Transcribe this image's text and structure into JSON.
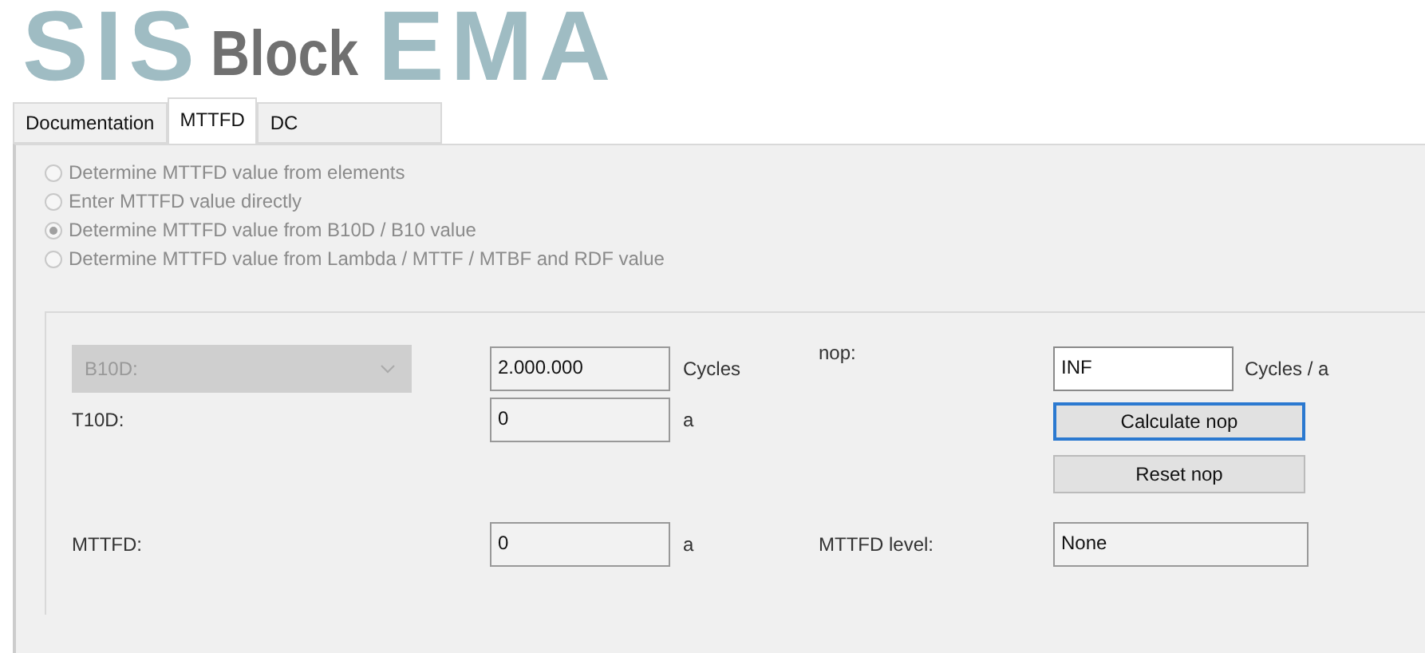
{
  "header": {
    "logo_parts": [
      "SIS",
      "EMA"
    ],
    "title": "Block"
  },
  "tabs": [
    {
      "label": "Documentation",
      "selected": false
    },
    {
      "label": "MTTFD",
      "selected": true
    },
    {
      "label": "DC",
      "selected": false
    }
  ],
  "options": [
    {
      "label": "Determine MTTFD value from elements",
      "selected": false,
      "disabled": true
    },
    {
      "label": "Enter MTTFD value directly",
      "selected": false,
      "disabled": true
    },
    {
      "label": "Determine MTTFD value from B10D / B10 value",
      "selected": true,
      "disabled": true
    },
    {
      "label": "Determine MTTFD value from Lambda / MTTF / MTBF and RDF value",
      "selected": false,
      "disabled": true
    }
  ],
  "form": {
    "b10d": {
      "select": "B10D:",
      "disabled": true,
      "value": "2.000.000",
      "unit": "Cycles"
    },
    "nop": {
      "label": "nop:",
      "value": "INF",
      "unit": "Cycles / a",
      "editable": true
    },
    "t10d": {
      "label": "T10D:",
      "value": "0",
      "unit": "a"
    },
    "buttons": [
      {
        "label": "Calculate nop",
        "focused": true
      },
      {
        "label": "Reset nop",
        "focused": false
      }
    ],
    "mttfd": {
      "label": "MTTFD:",
      "value": "0",
      "unit": "a"
    },
    "mttfd_level": {
      "label": "MTTFD level:",
      "value": "None"
    }
  }
}
